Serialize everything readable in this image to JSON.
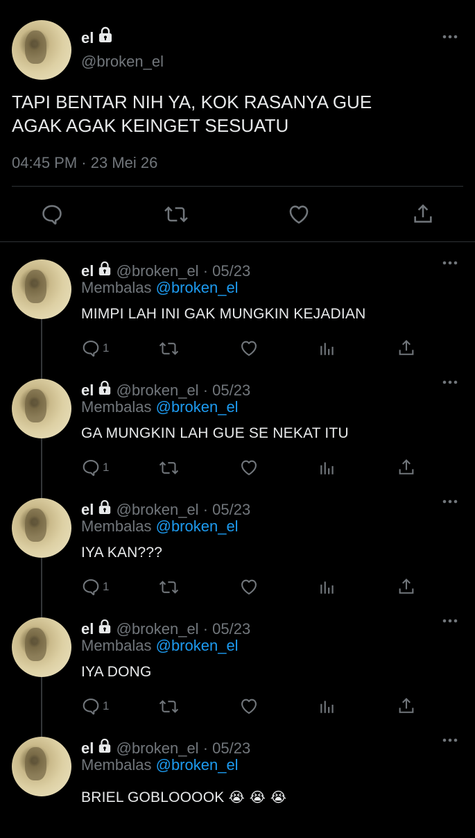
{
  "main_tweet": {
    "name": "el",
    "handle": "@broken_el",
    "text_line1": "TAPI BENTAR NIH YA, KOK RASANYA GUE",
    "text_line2": "AGAK AGAK KEINGET SESUATU",
    "time": "04:45 PM",
    "separator": "·",
    "date": "23 Mei 26",
    "actions": [
      "reply-icon",
      "retweet-icon",
      "like-icon",
      "share-icon"
    ]
  },
  "replies": [
    {
      "name": "el",
      "handle": "@broken_el",
      "date": "05/23",
      "replying_label": "Membalas",
      "replying_to": "@broken_el",
      "text": "MIMPI LAH INI GAK MUNGKIN KEJADIAN",
      "reply_count": "1"
    },
    {
      "name": "el",
      "handle": "@broken_el",
      "date": "05/23",
      "replying_label": "Membalas",
      "replying_to": "@broken_el",
      "text": "GA MUNGKIN LAH GUE SE NEKAT ITU",
      "reply_count": "1"
    },
    {
      "name": "el",
      "handle": "@broken_el",
      "date": "05/23",
      "replying_label": "Membalas",
      "replying_to": "@broken_el",
      "text": "IYA KAN???",
      "reply_count": "1"
    },
    {
      "name": "el",
      "handle": "@broken_el",
      "date": "05/23",
      "replying_label": "Membalas",
      "replying_to": "@broken_el",
      "text": "IYA DONG",
      "reply_count": "1"
    },
    {
      "name": "el",
      "handle": "@broken_el",
      "date": "05/23",
      "replying_label": "Membalas",
      "replying_to": "@broken_el",
      "text": "BRIEL GOBLOOOOK",
      "emoji": "😭 😭 😭"
    }
  ],
  "reply_actions": [
    "reply-icon",
    "retweet-icon",
    "like-icon",
    "analytics-icon",
    "share-icon"
  ],
  "more_icon": "⋯",
  "colors": {
    "background": "#000000",
    "text": "#e7e9ea",
    "muted": "#71767b",
    "link": "#1d9bf0",
    "divider": "#2f3336"
  }
}
